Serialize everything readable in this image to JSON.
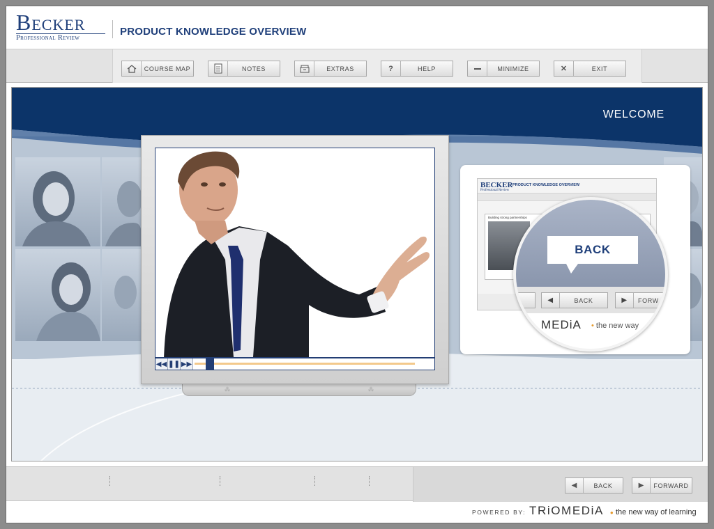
{
  "header": {
    "logo_main": "Becker",
    "logo_sub": "Professional Review",
    "course_title": "PRODUCT KNOWLEDGE OVERVIEW"
  },
  "toolbar": {
    "buttons": [
      {
        "label": "COURSE MAP",
        "icon": "home-icon"
      },
      {
        "label": "NOTES",
        "icon": "notes-icon"
      },
      {
        "label": "EXTRAS",
        "icon": "extras-icon"
      },
      {
        "label": "HELP",
        "icon": "help-icon"
      },
      {
        "label": "MINIMIZE",
        "icon": "minimize-icon"
      },
      {
        "label": "EXIT",
        "icon": "close-icon"
      }
    ]
  },
  "stage": {
    "section_title": "WELCOME",
    "video": {
      "progress": 0.06
    },
    "preview": {
      "mini_logo": "BECKER",
      "mini_logo_sub": "Professional Review",
      "mini_title": "PRODUCT KNOWLEDGE OVERVIEW",
      "mini_caption": "Building strong partnerships",
      "callout": "BACK",
      "back_label": "BACK",
      "forward_label": "FORW",
      "brand": "MEDiA",
      "brand_tag": "the new way"
    }
  },
  "nav": {
    "back_label": "BACK",
    "forward_label": "FORWARD"
  },
  "footer": {
    "powered_by": "POWERED BY:",
    "brand": "TRiOMEDiA",
    "tagline": "the new way of learning"
  },
  "colors": {
    "navy": "#1f3f7a",
    "stage_band": "#0c3469",
    "accent_orange": "#e69a2b"
  }
}
